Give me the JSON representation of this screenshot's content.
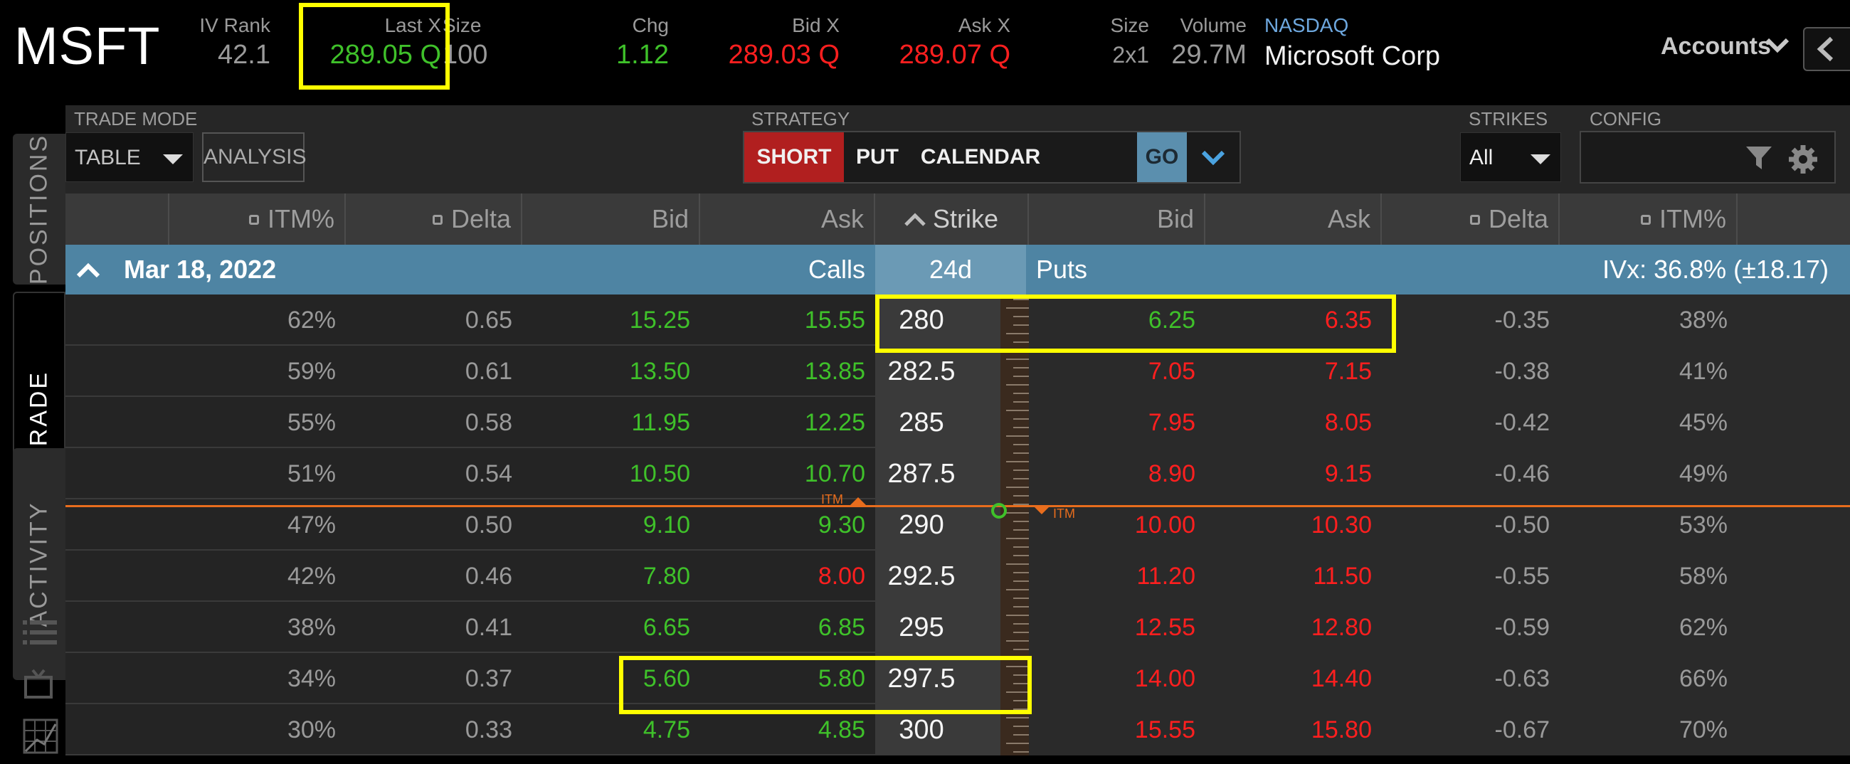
{
  "quote": {
    "symbol": "MSFT",
    "iv_rank_label": "IV Rank",
    "iv_rank": "42.1",
    "last_label": "Last X",
    "last": "289.05 Q",
    "size_label": "Size",
    "size": "100",
    "chg_label": "Chg",
    "chg": "1.12",
    "bid_label": "Bid X",
    "bid": "289.03 Q",
    "ask_label": "Ask X",
    "ask": "289.07 Q",
    "size2_label": "Size",
    "size2": "2x1",
    "volume_label": "Volume",
    "volume": "29.7M",
    "exchange": "NASDAQ",
    "company": "Microsoft Corp",
    "accounts_label": "Accounts"
  },
  "side_tabs": [
    "POSITIONS",
    "TRADE",
    "ACTIVITY"
  ],
  "toolbar": {
    "trade_mode_label": "TRADE MODE",
    "trade_mode_value": "TABLE",
    "analysis_label": "ANALYSIS",
    "strategy_label": "STRATEGY",
    "strategy_side": "SHORT",
    "strategy_type": "PUT",
    "strategy_name": "CALENDAR",
    "go_label": "GO",
    "strikes_label": "STRIKES",
    "strikes_value": "All",
    "config_label": "CONFIG"
  },
  "columns": {
    "call_itm": "ITM%",
    "call_delta": "Delta",
    "call_bid": "Bid",
    "call_ask": "Ask",
    "strike": "Strike",
    "put_bid": "Bid",
    "put_ask": "Ask",
    "put_delta": "Delta",
    "put_itm": "ITM%"
  },
  "expiry": {
    "date": "Mar 18, 2022",
    "calls_label": "Calls",
    "days": "24d",
    "puts_label": "Puts",
    "ivx": "IVx: 36.8% (±18.17)"
  },
  "itm_tag": "ITM",
  "colors": {
    "green": "#3fc12a",
    "red": "#ff1f1f",
    "highlight": "#ffff00",
    "short_bg": "#b11f1f",
    "go_bg": "#5b8fae",
    "expiry_bg": "#4e84a3",
    "itm_line": "#e86d1d"
  },
  "rows": [
    {
      "call_itm": "62%",
      "call_delta": "0.65",
      "call_bid": "15.25",
      "call_ask": "15.55",
      "strike": "280",
      "put_bid": "6.25",
      "put_ask": "6.35",
      "put_delta": "-0.35",
      "put_itm": "38%",
      "call_bid_color": "green",
      "call_ask_color": "green",
      "put_bid_color": "green",
      "put_ask_color": "red"
    },
    {
      "call_itm": "59%",
      "call_delta": "0.61",
      "call_bid": "13.50",
      "call_ask": "13.85",
      "strike": "282.5",
      "put_bid": "7.05",
      "put_ask": "7.15",
      "put_delta": "-0.38",
      "put_itm": "41%",
      "call_bid_color": "green",
      "call_ask_color": "green",
      "put_bid_color": "red",
      "put_ask_color": "red"
    },
    {
      "call_itm": "55%",
      "call_delta": "0.58",
      "call_bid": "11.95",
      "call_ask": "12.25",
      "strike": "285",
      "put_bid": "7.95",
      "put_ask": "8.05",
      "put_delta": "-0.42",
      "put_itm": "45%",
      "call_bid_color": "green",
      "call_ask_color": "green",
      "put_bid_color": "red",
      "put_ask_color": "red"
    },
    {
      "call_itm": "51%",
      "call_delta": "0.54",
      "call_bid": "10.50",
      "call_ask": "10.70",
      "strike": "287.5",
      "put_bid": "8.90",
      "put_ask": "9.15",
      "put_delta": "-0.46",
      "put_itm": "49%",
      "call_bid_color": "green",
      "call_ask_color": "green",
      "put_bid_color": "red",
      "put_ask_color": "red"
    },
    {
      "call_itm": "47%",
      "call_delta": "0.50",
      "call_bid": "9.10",
      "call_ask": "9.30",
      "strike": "290",
      "put_bid": "10.00",
      "put_ask": "10.30",
      "put_delta": "-0.50",
      "put_itm": "53%",
      "call_bid_color": "green",
      "call_ask_color": "green",
      "put_bid_color": "red",
      "put_ask_color": "red"
    },
    {
      "call_itm": "42%",
      "call_delta": "0.46",
      "call_bid": "7.80",
      "call_ask": "8.00",
      "strike": "292.5",
      "put_bid": "11.20",
      "put_ask": "11.50",
      "put_delta": "-0.55",
      "put_itm": "58%",
      "call_bid_color": "green",
      "call_ask_color": "red",
      "put_bid_color": "red",
      "put_ask_color": "red"
    },
    {
      "call_itm": "38%",
      "call_delta": "0.41",
      "call_bid": "6.65",
      "call_ask": "6.85",
      "strike": "295",
      "put_bid": "12.55",
      "put_ask": "12.80",
      "put_delta": "-0.59",
      "put_itm": "62%",
      "call_bid_color": "green",
      "call_ask_color": "green",
      "put_bid_color": "red",
      "put_ask_color": "red"
    },
    {
      "call_itm": "34%",
      "call_delta": "0.37",
      "call_bid": "5.60",
      "call_ask": "5.80",
      "strike": "297.5",
      "put_bid": "14.00",
      "put_ask": "14.40",
      "put_delta": "-0.63",
      "put_itm": "66%",
      "call_bid_color": "green",
      "call_ask_color": "green",
      "put_bid_color": "red",
      "put_ask_color": "red"
    },
    {
      "call_itm": "30%",
      "call_delta": "0.33",
      "call_bid": "4.75",
      "call_ask": "4.85",
      "strike": "300",
      "put_bid": "15.55",
      "put_ask": "15.80",
      "put_delta": "-0.67",
      "put_itm": "70%",
      "call_bid_color": "green",
      "call_ask_color": "green",
      "put_bid_color": "red",
      "put_ask_color": "red"
    }
  ]
}
